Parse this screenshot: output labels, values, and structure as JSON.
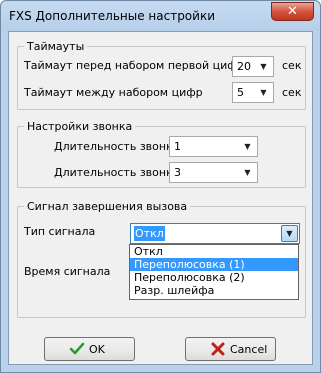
{
  "window": {
    "title": "FXS Дополнительные настройки",
    "close_label": "✕"
  },
  "timeouts": {
    "legend": "Таймауты",
    "first_digit_label": "Таймаут перед набором первой цифры",
    "first_digit_value": "20",
    "first_digit_unit": "сек",
    "between_digits_label": "Таймаут между набором цифр",
    "between_digits_value": "5",
    "between_digits_unit": "сек"
  },
  "ring": {
    "legend": "Настройки звонка",
    "duration1_label": "Длительность звонка",
    "duration1_value": "1",
    "duration2_label": "Длительность звонка",
    "duration2_value": "3"
  },
  "end_signal": {
    "legend": "Сигнал завершения вызова",
    "type_label": "Тип сигнала",
    "type_value": "Откл",
    "time_label": "Время сигнала",
    "options": [
      "Откл",
      "Переполюсовка (1)",
      "Переполюсовка (2)",
      "Разр. шлейфа"
    ],
    "highlighted_index": 1
  },
  "buttons": {
    "ok_label": "OK",
    "cancel_label": "Cancel"
  },
  "colors": {
    "accent": "#3399ff",
    "ok_check": "#2e9a2e",
    "cancel_x": "#c0201a"
  }
}
